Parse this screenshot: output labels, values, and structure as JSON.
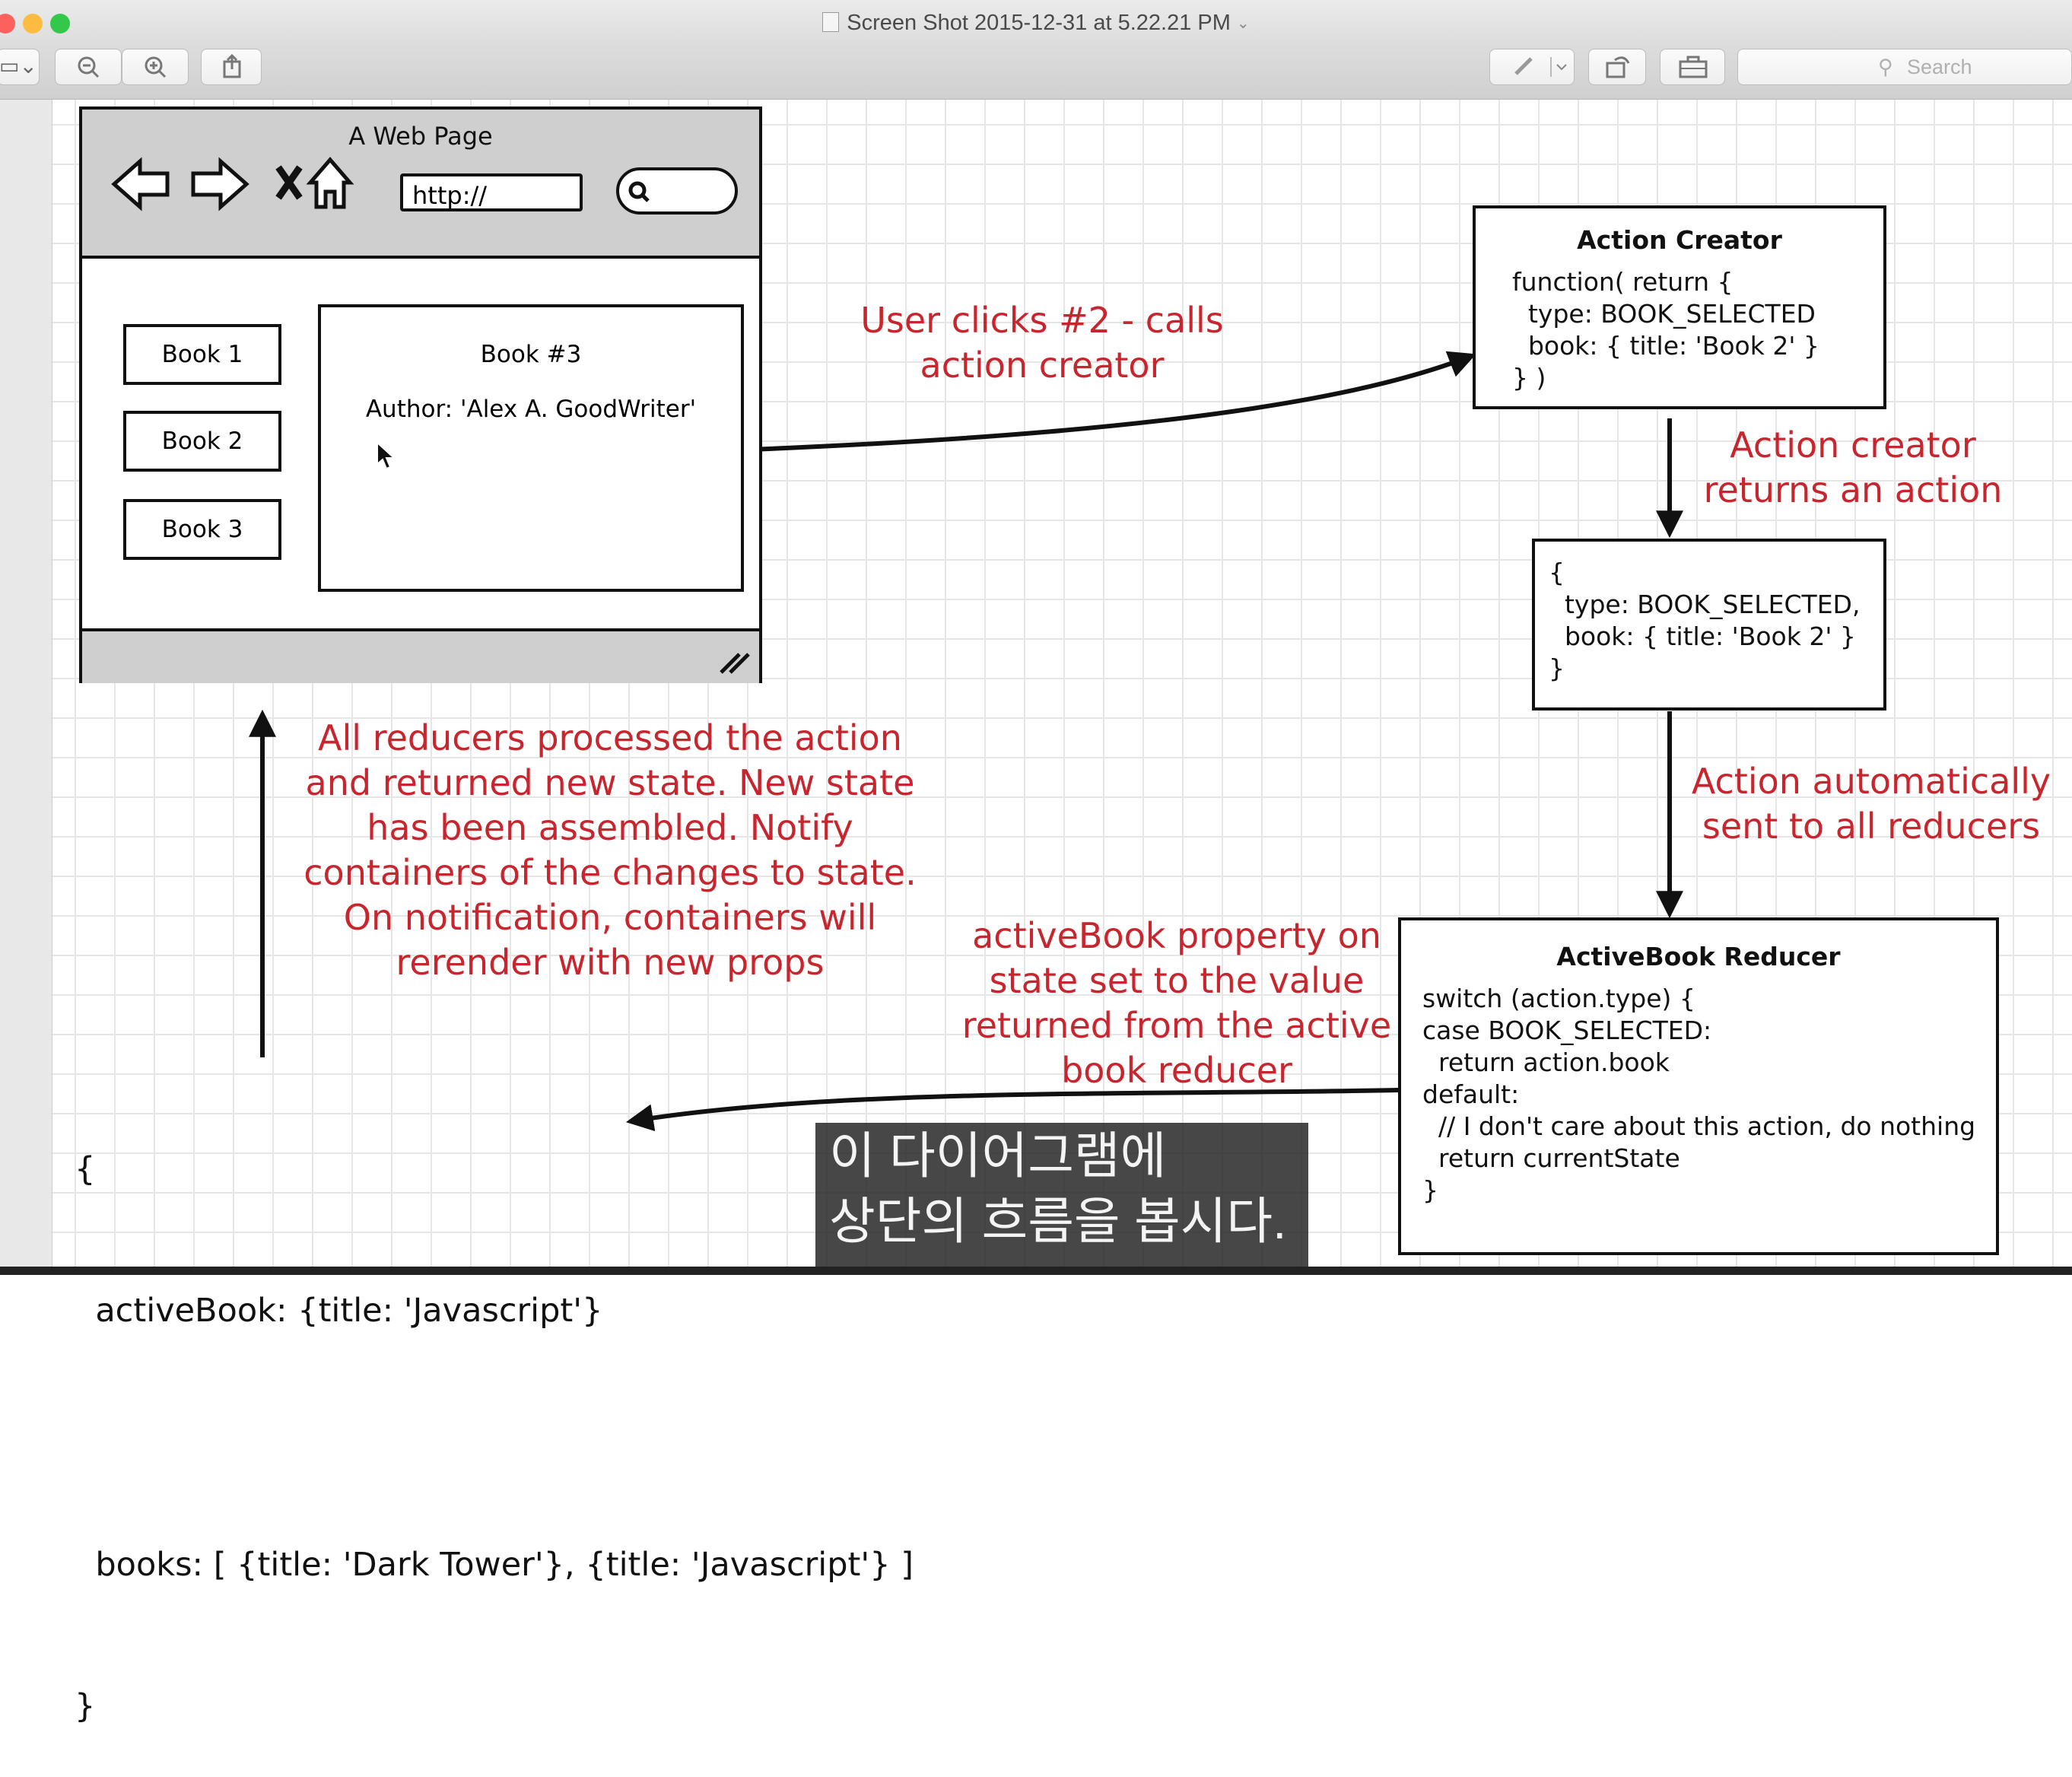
{
  "window": {
    "title": "Screen Shot 2015-12-31 at 5.22.21 PM",
    "search_placeholder": "Search"
  },
  "toolbar": {
    "icons": [
      "sidebar-icon",
      "zoom-out-icon",
      "zoom-in-icon",
      "share-icon",
      "markup-pen-icon",
      "rotate-icon",
      "toolbox-icon",
      "search-icon"
    ]
  },
  "browser": {
    "title": "A Web Page",
    "url": "http://",
    "books": [
      "Book 1",
      "Book 2",
      "Book 3"
    ],
    "detail_title": "Book #3",
    "detail_author": "Author: 'Alex A. GoodWriter'"
  },
  "notes": {
    "user_clicks": [
      "User clicks #2 - calls",
      "action creator"
    ],
    "creator_returns": [
      "Action creator",
      "returns an action"
    ],
    "auto_sent": [
      "Action automatically",
      "sent to all reducers"
    ],
    "active_book_prop": [
      "activeBook property on",
      "state set to the value",
      "returned from the active",
      "book reducer"
    ],
    "all_reducers": [
      "All reducers processed the action",
      "and returned new state.  New state",
      "has been assembled.  Notify",
      "containers of the changes to state.",
      "On notification, containers will",
      "rerender with new props"
    ]
  },
  "action_creator": {
    "title": "Action Creator",
    "code": [
      "function( return {",
      "  type: BOOK_SELECTED",
      "  book: { title: 'Book 2' }",
      "} )"
    ]
  },
  "action_object": {
    "code": [
      "{",
      "  type: BOOK_SELECTED,",
      "  book: { title: 'Book 2' }",
      "}"
    ]
  },
  "reducer": {
    "title": "ActiveBook Reducer",
    "code": [
      "switch (action.type) {",
      "case BOOK_SELECTED:",
      "  return action.book",
      "default:",
      "  // I don't care about this action, do nothing",
      "  return currentState",
      "}"
    ]
  },
  "state": {
    "code": [
      "{",
      "  activeBook: {title: 'Javascript'}",
      "  books: [ {title: 'Dark Tower'}, {title: 'Javascript'} ]",
      "}"
    ]
  },
  "subtitle": [
    "이 다이어그램에",
    "상단의 흐름을 봅시다."
  ],
  "colors": {
    "note_red": "#c8262e",
    "ink": "#111111",
    "grid": "#e6e6e6"
  }
}
